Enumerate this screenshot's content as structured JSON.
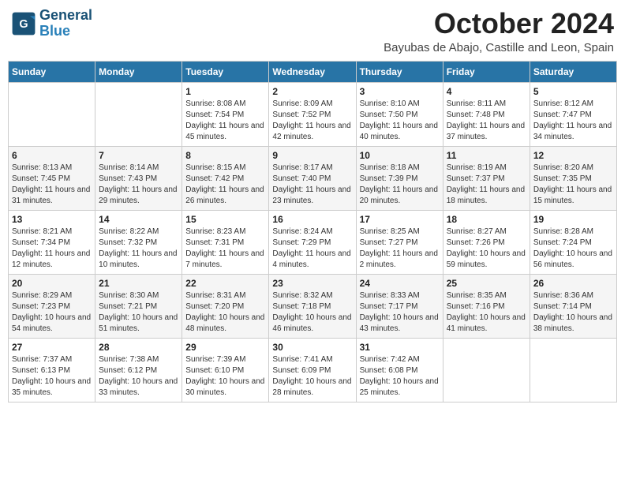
{
  "header": {
    "logo_line1": "General",
    "logo_line2": "Blue",
    "month": "October 2024",
    "location": "Bayubas de Abajo, Castille and Leon, Spain"
  },
  "weekdays": [
    "Sunday",
    "Monday",
    "Tuesday",
    "Wednesday",
    "Thursday",
    "Friday",
    "Saturday"
  ],
  "weeks": [
    [
      {
        "day": "",
        "info": ""
      },
      {
        "day": "",
        "info": ""
      },
      {
        "day": "1",
        "info": "Sunrise: 8:08 AM\nSunset: 7:54 PM\nDaylight: 11 hours and 45 minutes."
      },
      {
        "day": "2",
        "info": "Sunrise: 8:09 AM\nSunset: 7:52 PM\nDaylight: 11 hours and 42 minutes."
      },
      {
        "day": "3",
        "info": "Sunrise: 8:10 AM\nSunset: 7:50 PM\nDaylight: 11 hours and 40 minutes."
      },
      {
        "day": "4",
        "info": "Sunrise: 8:11 AM\nSunset: 7:48 PM\nDaylight: 11 hours and 37 minutes."
      },
      {
        "day": "5",
        "info": "Sunrise: 8:12 AM\nSunset: 7:47 PM\nDaylight: 11 hours and 34 minutes."
      }
    ],
    [
      {
        "day": "6",
        "info": "Sunrise: 8:13 AM\nSunset: 7:45 PM\nDaylight: 11 hours and 31 minutes."
      },
      {
        "day": "7",
        "info": "Sunrise: 8:14 AM\nSunset: 7:43 PM\nDaylight: 11 hours and 29 minutes."
      },
      {
        "day": "8",
        "info": "Sunrise: 8:15 AM\nSunset: 7:42 PM\nDaylight: 11 hours and 26 minutes."
      },
      {
        "day": "9",
        "info": "Sunrise: 8:17 AM\nSunset: 7:40 PM\nDaylight: 11 hours and 23 minutes."
      },
      {
        "day": "10",
        "info": "Sunrise: 8:18 AM\nSunset: 7:39 PM\nDaylight: 11 hours and 20 minutes."
      },
      {
        "day": "11",
        "info": "Sunrise: 8:19 AM\nSunset: 7:37 PM\nDaylight: 11 hours and 18 minutes."
      },
      {
        "day": "12",
        "info": "Sunrise: 8:20 AM\nSunset: 7:35 PM\nDaylight: 11 hours and 15 minutes."
      }
    ],
    [
      {
        "day": "13",
        "info": "Sunrise: 8:21 AM\nSunset: 7:34 PM\nDaylight: 11 hours and 12 minutes."
      },
      {
        "day": "14",
        "info": "Sunrise: 8:22 AM\nSunset: 7:32 PM\nDaylight: 11 hours and 10 minutes."
      },
      {
        "day": "15",
        "info": "Sunrise: 8:23 AM\nSunset: 7:31 PM\nDaylight: 11 hours and 7 minutes."
      },
      {
        "day": "16",
        "info": "Sunrise: 8:24 AM\nSunset: 7:29 PM\nDaylight: 11 hours and 4 minutes."
      },
      {
        "day": "17",
        "info": "Sunrise: 8:25 AM\nSunset: 7:27 PM\nDaylight: 11 hours and 2 minutes."
      },
      {
        "day": "18",
        "info": "Sunrise: 8:27 AM\nSunset: 7:26 PM\nDaylight: 10 hours and 59 minutes."
      },
      {
        "day": "19",
        "info": "Sunrise: 8:28 AM\nSunset: 7:24 PM\nDaylight: 10 hours and 56 minutes."
      }
    ],
    [
      {
        "day": "20",
        "info": "Sunrise: 8:29 AM\nSunset: 7:23 PM\nDaylight: 10 hours and 54 minutes."
      },
      {
        "day": "21",
        "info": "Sunrise: 8:30 AM\nSunset: 7:21 PM\nDaylight: 10 hours and 51 minutes."
      },
      {
        "day": "22",
        "info": "Sunrise: 8:31 AM\nSunset: 7:20 PM\nDaylight: 10 hours and 48 minutes."
      },
      {
        "day": "23",
        "info": "Sunrise: 8:32 AM\nSunset: 7:18 PM\nDaylight: 10 hours and 46 minutes."
      },
      {
        "day": "24",
        "info": "Sunrise: 8:33 AM\nSunset: 7:17 PM\nDaylight: 10 hours and 43 minutes."
      },
      {
        "day": "25",
        "info": "Sunrise: 8:35 AM\nSunset: 7:16 PM\nDaylight: 10 hours and 41 minutes."
      },
      {
        "day": "26",
        "info": "Sunrise: 8:36 AM\nSunset: 7:14 PM\nDaylight: 10 hours and 38 minutes."
      }
    ],
    [
      {
        "day": "27",
        "info": "Sunrise: 7:37 AM\nSunset: 6:13 PM\nDaylight: 10 hours and 35 minutes."
      },
      {
        "day": "28",
        "info": "Sunrise: 7:38 AM\nSunset: 6:12 PM\nDaylight: 10 hours and 33 minutes."
      },
      {
        "day": "29",
        "info": "Sunrise: 7:39 AM\nSunset: 6:10 PM\nDaylight: 10 hours and 30 minutes."
      },
      {
        "day": "30",
        "info": "Sunrise: 7:41 AM\nSunset: 6:09 PM\nDaylight: 10 hours and 28 minutes."
      },
      {
        "day": "31",
        "info": "Sunrise: 7:42 AM\nSunset: 6:08 PM\nDaylight: 10 hours and 25 minutes."
      },
      {
        "day": "",
        "info": ""
      },
      {
        "day": "",
        "info": ""
      }
    ]
  ]
}
